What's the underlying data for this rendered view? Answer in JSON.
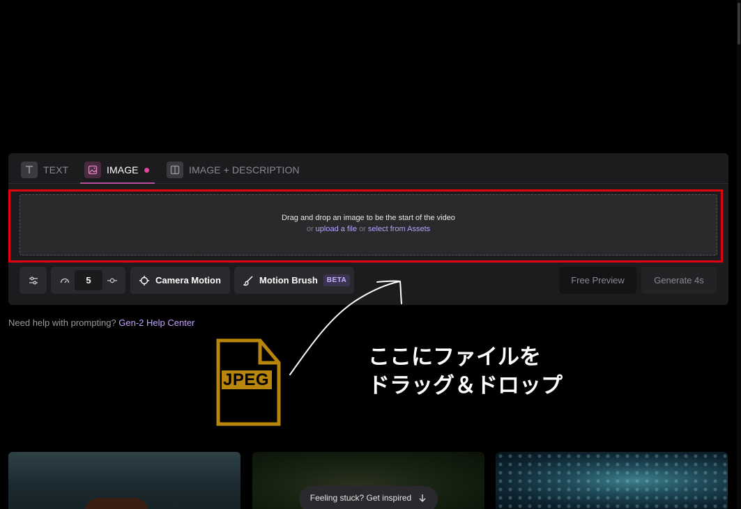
{
  "tabs": [
    {
      "label": "TEXT",
      "icon": "text-icon"
    },
    {
      "label": "IMAGE",
      "icon": "image-icon",
      "active": true
    },
    {
      "label": "IMAGE + DESCRIPTION",
      "icon": "split-panel-icon"
    }
  ],
  "dropzone": {
    "main_text": "Drag and drop an image to be the start of the video",
    "or_1": "or",
    "upload_link": "upload a file",
    "or_2": "or",
    "assets_link": "select from Assets"
  },
  "toolbar": {
    "duration_value": "5",
    "camera_motion_label": "Camera Motion",
    "motion_brush_label": "Motion Brush",
    "beta_badge": "BETA",
    "free_preview_label": "Free Preview",
    "generate_label": "Generate 4s"
  },
  "help": {
    "prefix": "Need help with prompting?",
    "link": "Gen-2 Help Center"
  },
  "annotation": {
    "file_label": "JPEG",
    "note_line1": "ここにファイルを",
    "note_line2": "ドラッグ＆ドロップ"
  },
  "inspire_label": "Feeling stuck? Get inspired",
  "colors": {
    "accent_pink": "#e3459f",
    "link_purple": "#c2a5ff",
    "highlight_red": "#e10010",
    "jpeg_gold": "#b8860b"
  }
}
